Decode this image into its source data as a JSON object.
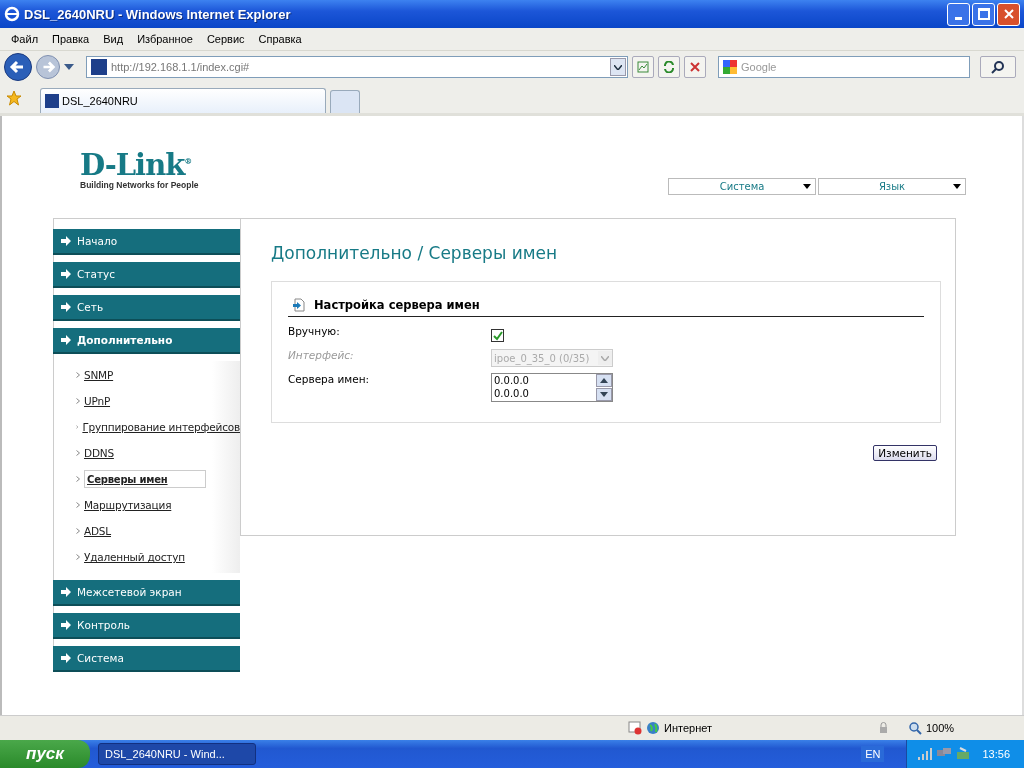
{
  "window": {
    "title": "DSL_2640NRU - Windows Internet Explorer"
  },
  "menu_bar": [
    "Файл",
    "Правка",
    "Вид",
    "Избранное",
    "Сервис",
    "Справка"
  ],
  "address_bar": {
    "url": "http://192.168.1.1/index.cgi#"
  },
  "search": {
    "placeholder": "Google"
  },
  "tabs": [
    {
      "label": "DSL_2640NRU",
      "selected": true
    }
  ],
  "logo": {
    "name": "D-Link$^{®}$",
    "tagline": "Building Networks for People"
  },
  "top_menus": [
    "Система",
    "Язык"
  ],
  "sidebar": {
    "items": [
      {
        "label": "Начало",
        "expanded": false
      },
      {
        "label": "Статус",
        "expanded": false
      },
      {
        "label": "Сеть",
        "expanded": false
      },
      {
        "label": "Дополнительно",
        "expanded": true,
        "children": [
          {
            "label": "SNMP",
            "selected": false
          },
          {
            "label": "UPnP",
            "selected": false
          },
          {
            "label": "Группирование интерфейсов",
            "selected": false
          },
          {
            "label": "DDNS",
            "selected": false
          },
          {
            "label": "Серверы имен",
            "selected": true
          },
          {
            "label": "Маршрутизация",
            "selected": false
          },
          {
            "label": "ADSL",
            "selected": false
          },
          {
            "label": "Удаленный доступ",
            "selected": false
          }
        ]
      },
      {
        "label": "Межсетевой экран",
        "expanded": false
      },
      {
        "label": "Контроль",
        "expanded": false
      },
      {
        "label": "Система",
        "expanded": false
      }
    ]
  },
  "page_title": "Дополнительно / Серверы имен",
  "section": {
    "title": "Настройка сервера имен",
    "fields": [
      {
        "kind": "checkbox",
        "label": "Вручную:",
        "checked": true,
        "disabled": false
      },
      {
        "kind": "select",
        "label": "Интерфейс:",
        "value": "ipoe_0_35_0 (0/35)",
        "disabled": true
      },
      {
        "kind": "list",
        "label": "Сервера имен:",
        "values": [
          "0.0.0.0",
          "0.0.0.0"
        ],
        "disabled": false
      }
    ]
  },
  "apply_button": "Изменить",
  "status_bar": {
    "zone": "Интернет",
    "zoom": "100%"
  },
  "taskbar": {
    "start": "пуск",
    "tasks": [
      {
        "label": "DSL_2640NRU - Wind..."
      }
    ],
    "language": "EN",
    "clock": "13:56"
  }
}
